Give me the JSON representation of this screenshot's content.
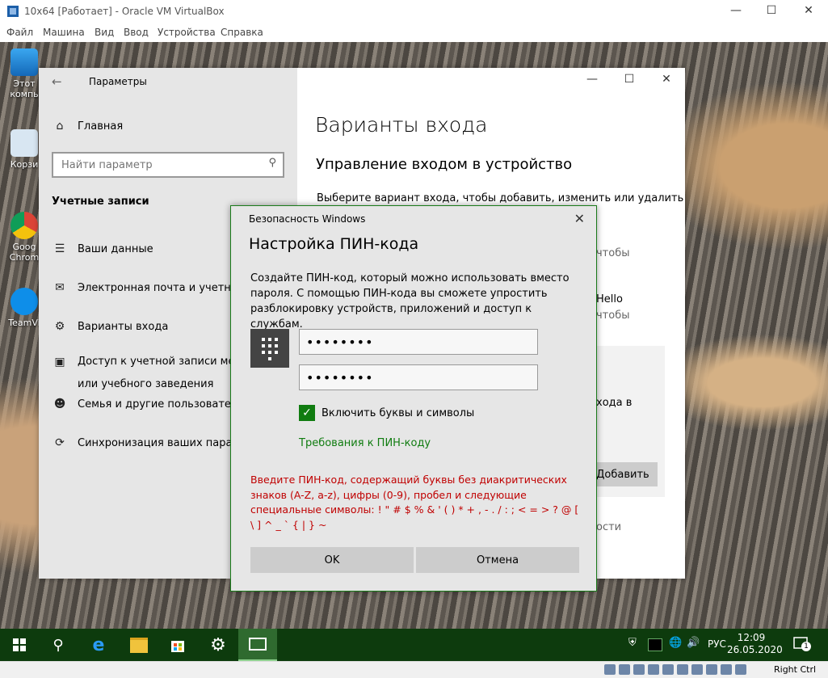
{
  "host": {
    "title": "10x64 [Работает] - Oracle VM VirtualBox",
    "menu": [
      "Файл",
      "Машина",
      "Вид",
      "Ввод",
      "Устройства",
      "Справка"
    ],
    "status_right": "Right Ctrl"
  },
  "desktop": {
    "icons": [
      "Этот компь",
      "Корзи",
      "Goog Chrom",
      "TeamVi"
    ]
  },
  "settings": {
    "window_title": "Параметры",
    "home": "Главная",
    "search_placeholder": "Найти параметр",
    "section": "Учетные записи",
    "nav": [
      "Ваши данные",
      "Электронная почта и учетные",
      "Варианты входа",
      "Доступ к учетной записи мес",
      "или учебного заведения",
      "Семья и другие пользователи",
      "Синхронизация ваших парам"
    ],
    "heading": "Варианты входа",
    "subheading": "Управление входом в устройство",
    "description": "Выберите вариант входа, чтобы добавить, изменить или удалить",
    "fragments": [
      "чтобы",
      "Hello",
      "чтобы",
      "хода в",
      "Добавить",
      "ости"
    ]
  },
  "dialog": {
    "caption": "Безопасность Windows",
    "title": "Настройка ПИН-кода",
    "description": "Создайте ПИН-код, который можно использовать вместо пароля. С помощью ПИН-кода вы сможете упростить разблокировку устройств, приложений и доступ к службам.",
    "pin_value": "••••••••",
    "pin_confirm_value": "••••••••",
    "checkbox_label": "Включить буквы и символы",
    "checkbox_checked": true,
    "requirements_link": "Требования к ПИН-коду",
    "error": "Введите ПИН-код, содержащий буквы без диакритических знаков (A-Z, a-z), цифры (0-9), пробел и следующие специальные символы: ! \" # $ % & ' ( ) * + , - . / : ; < = > ? @ [ \\ ] ^ _ ` { | } ~",
    "ok": "OK",
    "cancel": "Отмена"
  },
  "taskbar": {
    "language": "РУС",
    "time": "12:09",
    "date": "26.05.2020",
    "notifications": "1",
    "apps": [
      "start-icon",
      "search-icon",
      "edge-icon",
      "file-explorer-icon",
      "store-icon",
      "settings-icon",
      "security-icon"
    ]
  },
  "colors": {
    "accent": "#107c10",
    "error": "#c00000",
    "taskbar": "#0d3b0d"
  }
}
